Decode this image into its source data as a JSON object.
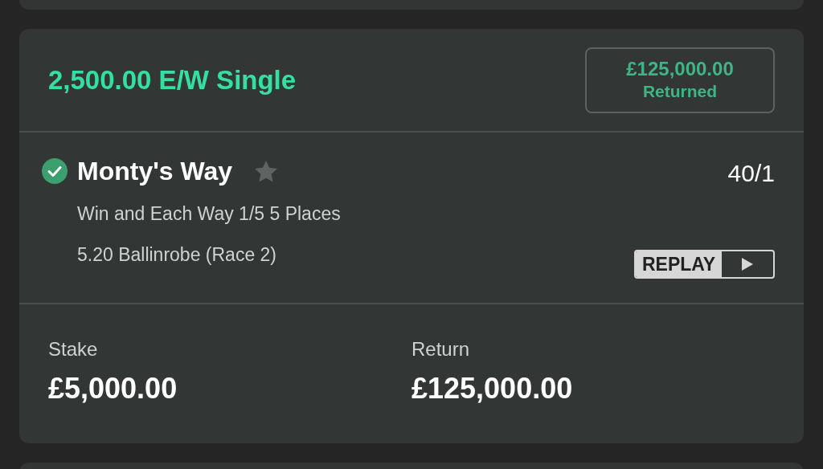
{
  "bet": {
    "title": "2,500.00 E/W Single",
    "returned": {
      "amount": "£125,000.00",
      "label": "Returned"
    },
    "selection": {
      "name": "Monty's Way",
      "won": true,
      "favourite": false,
      "odds": "40/1",
      "market": "Win and Each Way 1/5 5 Places",
      "event": "5.20 Ballinrobe (Race 2)",
      "replay_label": "REPLAY"
    },
    "totals": [
      {
        "label": "Stake",
        "value": "£5,000.00"
      },
      {
        "label": "Return",
        "value": "£125,000.00"
      }
    ]
  }
}
